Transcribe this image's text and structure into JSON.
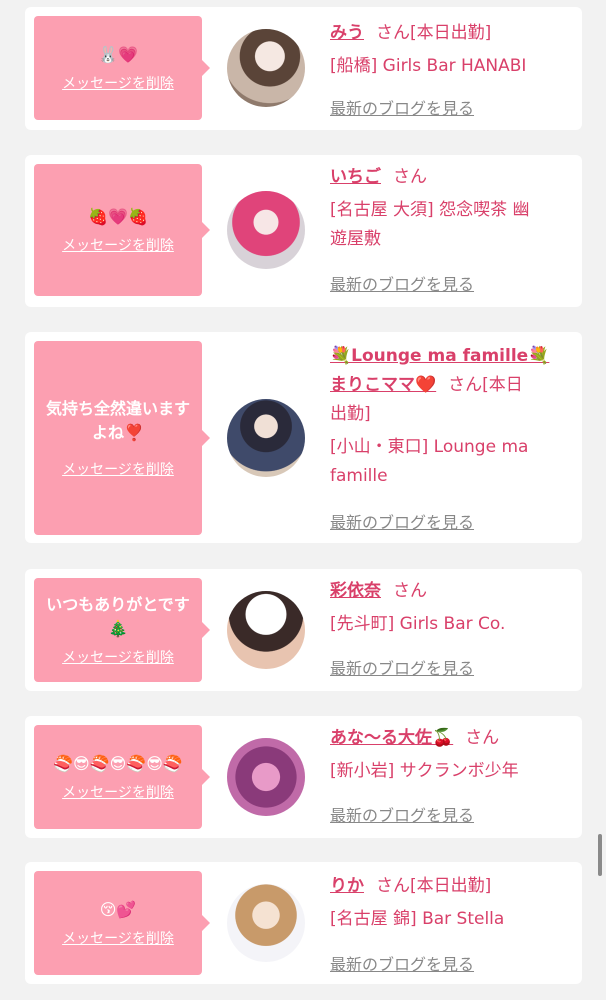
{
  "colors": {
    "accent": "#d9406a",
    "bubble": "#fc9fb1",
    "card": "#ffffff",
    "bg": "#f2f2f2",
    "link_gray": "#888888"
  },
  "entries": [
    {
      "message": "🐰💗",
      "delete_label": "メッセージを削除",
      "name": "みう",
      "san": "さん",
      "status": "[本日出勤]",
      "shop_lines": [
        "[船橋] Girls Bar HANABI"
      ],
      "blog_label": "最新のブログを見る"
    },
    {
      "message": "🍓💗🍓",
      "delete_label": "メッセージを削除",
      "name": "いちご",
      "san": "さん",
      "status": "",
      "shop_lines": [
        "[名古屋 大須] 怨念喫茶 幽",
        "遊屋敷"
      ],
      "blog_label": "最新のブログを見る"
    },
    {
      "message": "気持ち全然違いますよね❣️",
      "delete_label": "メッセージを削除",
      "name_prefix": "💐Lounge ma famille💐",
      "name": "まりこママ❤️",
      "san": "さん",
      "status": "[本日",
      "status_cont": "出勤]",
      "shop_lines": [
        "[小山・東口] Lounge ma",
        "famille"
      ],
      "blog_label": "最新のブログを見る"
    },
    {
      "message": "いつもありがとです🎄",
      "delete_label": "メッセージを削除",
      "name": "彩依奈",
      "san": "さん",
      "status": "",
      "shop_lines": [
        "[先斗町] Girls Bar Co."
      ],
      "blog_label": "最新のブログを見る"
    },
    {
      "message": "🍣😎🍣😎🍣😎🍣",
      "delete_label": "メッセージを削除",
      "name": "あな〜る大佐🍒",
      "san": "さん",
      "status": "",
      "shop_lines": [
        "[新小岩] サクランボ少年"
      ],
      "blog_label": "最新のブログを見る"
    },
    {
      "message": "😚💕",
      "delete_label": "メッセージを削除",
      "name": "りか",
      "san": "さん",
      "status": "[本日出勤]",
      "shop_lines": [
        "[名古屋 錦] Bar Stella"
      ],
      "blog_label": "最新のブログを見る"
    }
  ]
}
